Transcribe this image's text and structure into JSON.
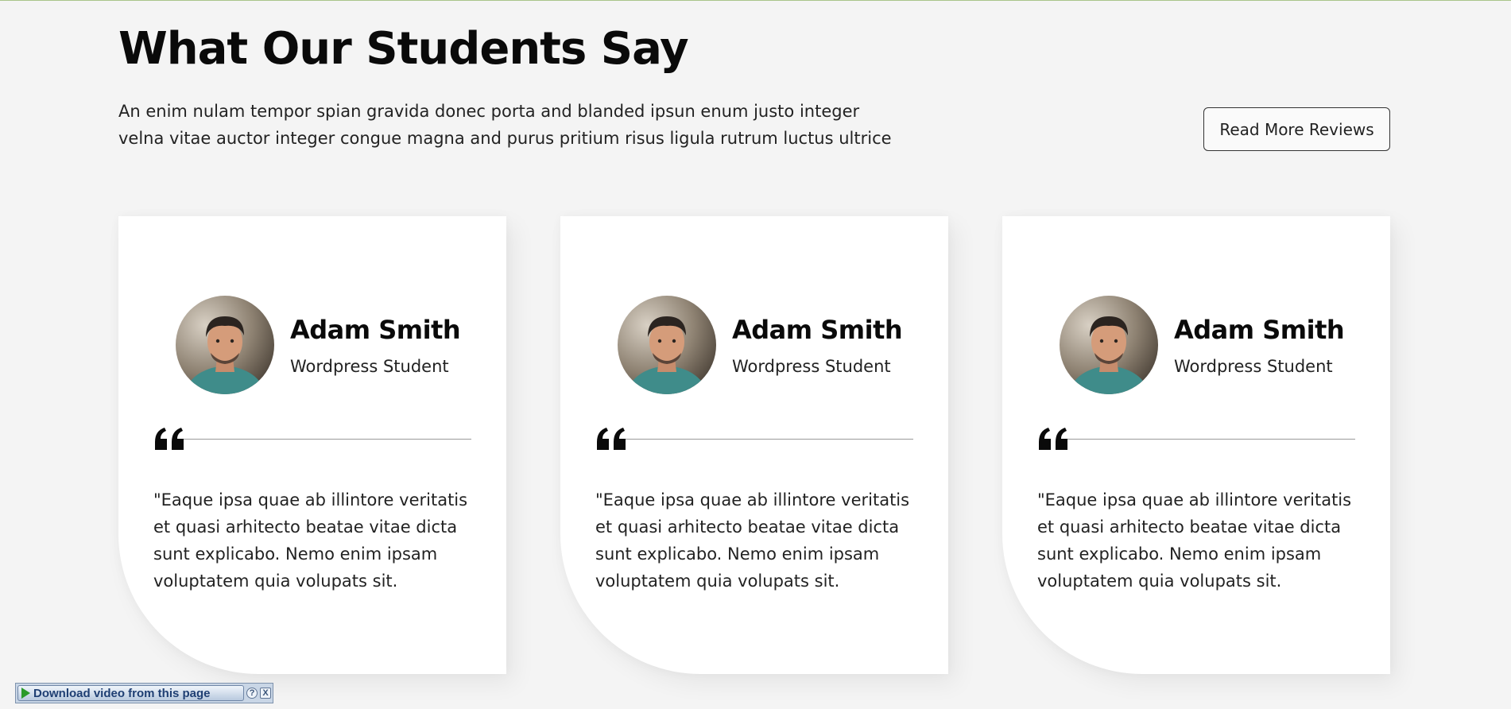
{
  "section": {
    "title": "What Our Students Say",
    "intro": "An enim nulam tempor spian gravida donec porta and blanded ipsun enum justo integer velna vitae auctor integer congue magna and purus pritium risus ligula rutrum luctus ultrice",
    "read_more_label": "Read More Reviews"
  },
  "testimonials": [
    {
      "name": "Adam Smith",
      "role": "Wordpress Student",
      "quote": "\"Eaque ipsa quae ab illintore veritatis et quasi arhitecto beatae vitae dicta sunt explicabo. Nemo enim ipsam voluptatem quia volupats sit."
    },
    {
      "name": "Adam Smith",
      "role": "Wordpress Student",
      "quote": "\"Eaque ipsa quae ab illintore veritatis et quasi arhitecto beatae vitae dicta sunt explicabo. Nemo enim ipsam voluptatem quia volupats sit."
    },
    {
      "name": "Adam Smith",
      "role": "Wordpress Student",
      "quote": "\"Eaque ipsa quae ab illintore veritatis et quasi arhitecto beatae vitae dicta sunt explicabo. Nemo enim ipsam voluptatem quia volupats sit."
    }
  ],
  "download_bar": {
    "label": "Download video from this page",
    "help_symbol": "?",
    "close_symbol": "X"
  },
  "colors": {
    "page_background": "#f4f4f4",
    "card_background": "#ffffff",
    "heading": "#0a0a0a",
    "body_text": "#222222",
    "top_rule": "#a9c58a"
  },
  "icons": {
    "quote": "quote-icon",
    "avatar": "avatar",
    "play": "play-icon"
  }
}
